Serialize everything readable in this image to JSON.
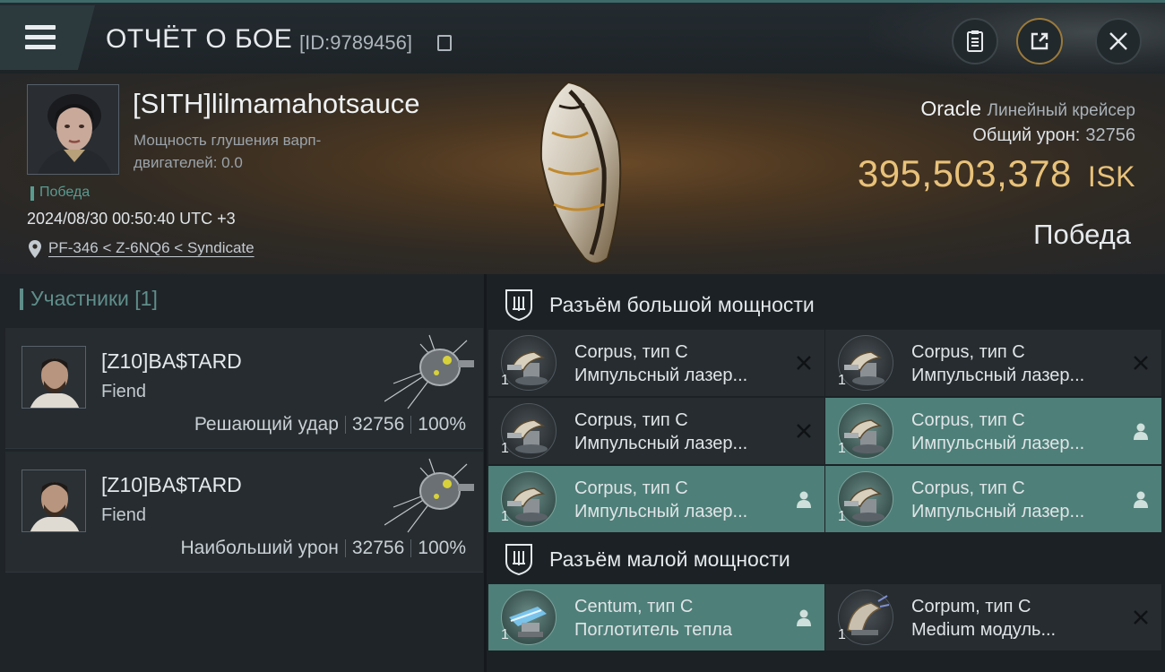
{
  "header": {
    "title": "ОТЧЁТ О БОЕ",
    "report_id": "[ID:9789456]",
    "icons": [
      "menu-icon",
      "copy-icon",
      "clipboard-icon",
      "share-icon",
      "close-icon"
    ]
  },
  "victim": {
    "name": "[SITH]lilmamahotsauce",
    "warp_scramble_label": "Мощность глушения варп-двигателей: 0.0",
    "result_tag": "Победа",
    "datetime": "2024/08/30 00:50:40 UTC +3",
    "location": "PF-346 < Z-6NQ6 < Syndicate",
    "ship_name": "Oracle",
    "ship_class": "Линейный крейсер",
    "total_damage_label": "Общий урон:",
    "total_damage": "32756",
    "isk_value": "395,503,378",
    "isk_unit": "ISK",
    "result": "Победа"
  },
  "participants": {
    "heading": "Участники [1]",
    "list": [
      {
        "name": "[Z10]BA$TARD",
        "ship": "Fiend",
        "role": "Решающий удар",
        "damage": "32756",
        "percent": "100%"
      },
      {
        "name": "[Z10]BA$TARD",
        "ship": "Fiend",
        "role": "Наибольший урон",
        "damage": "32756",
        "percent": "100%"
      }
    ]
  },
  "fitting": {
    "high_slot_heading": "Разъём большой мощности",
    "low_slot_heading": "Разъём малой мощности",
    "high_slots": [
      {
        "line1": "Corpus, тип C",
        "line2": "Импульсный лазер...",
        "qty": "1",
        "status": "destroyed",
        "active": false
      },
      {
        "line1": "Corpus, тип C",
        "line2": "Импульсный лазер...",
        "qty": "1",
        "status": "destroyed",
        "active": false
      },
      {
        "line1": "Corpus, тип C",
        "line2": "Импульсный лазер...",
        "qty": "1",
        "status": "destroyed",
        "active": false
      },
      {
        "line1": "Corpus, тип C",
        "line2": "Импульсный лазер...",
        "qty": "1",
        "status": "dropped",
        "active": true
      },
      {
        "line1": "Corpus, тип C",
        "line2": "Импульсный лазер...",
        "qty": "1",
        "status": "dropped",
        "active": true
      },
      {
        "line1": "Corpus, тип C",
        "line2": "Импульсный лазер...",
        "qty": "1",
        "status": "dropped",
        "active": true
      }
    ],
    "low_slots": [
      {
        "line1": "Centum, тип C",
        "line2": "Поглотитель тепла",
        "qty": "1",
        "status": "dropped",
        "active": true
      },
      {
        "line1": "Corpum, тип C",
        "line2": "Medium модуль...",
        "qty": "1",
        "status": "destroyed",
        "active": false
      }
    ]
  },
  "colors": {
    "accent_teal": "#4e7f78",
    "isk_gold": "#e8c27a",
    "background": "#15191d"
  }
}
